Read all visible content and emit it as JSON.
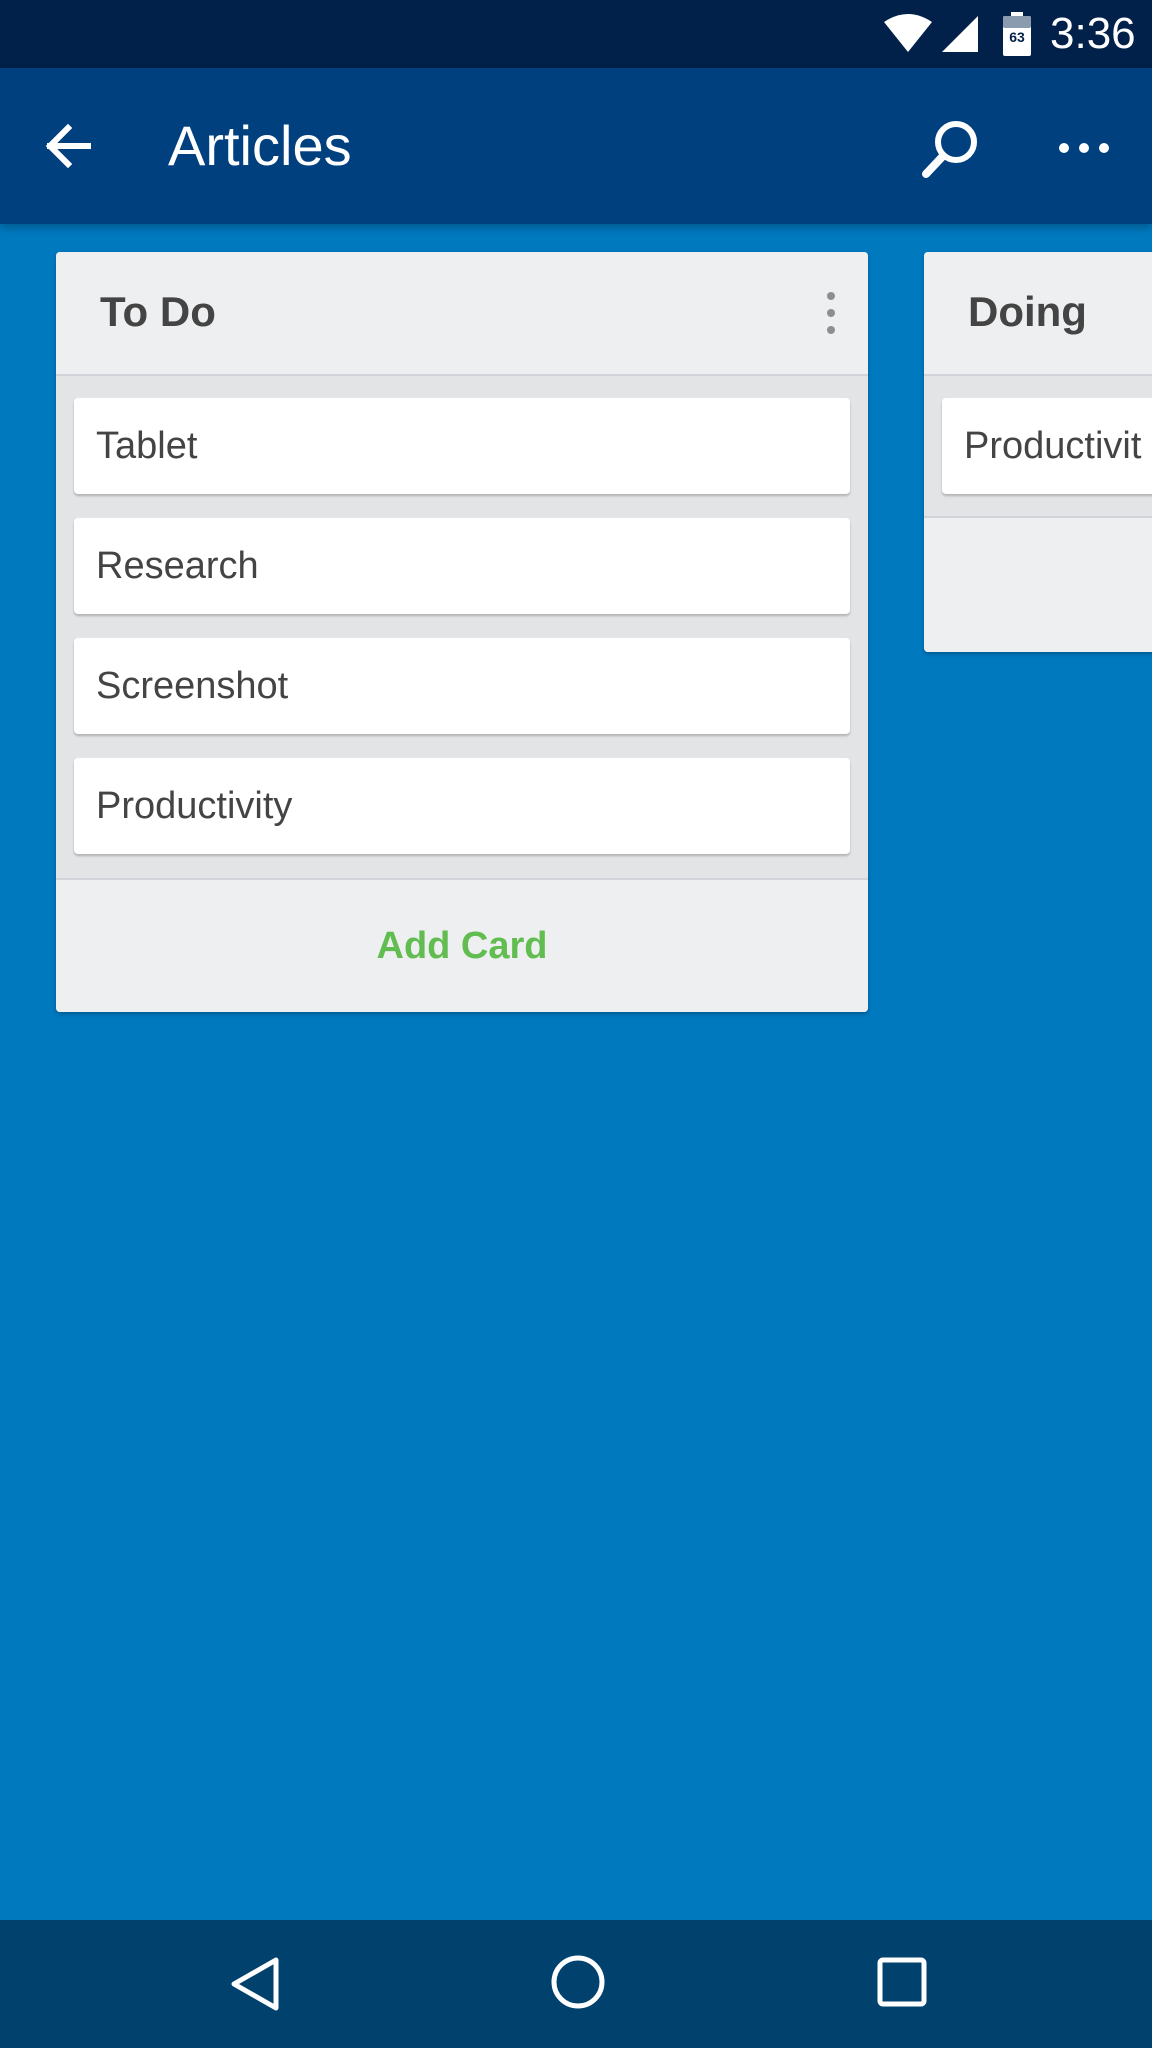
{
  "status_bar": {
    "time": "3:36",
    "battery_level": "63"
  },
  "app_bar": {
    "title": "Articles"
  },
  "lists": [
    {
      "title": "To Do",
      "cards": [
        "Tablet",
        "Research",
        "Screenshot",
        "Productivity"
      ],
      "add_card_label": "Add Card"
    },
    {
      "title": "Doing",
      "cards": [
        "Productivit"
      ]
    }
  ],
  "icons": {
    "back": "arrow-left-icon",
    "search": "search-icon",
    "more": "more-horizontal-icon",
    "list_menu": "more-vertical-icon",
    "nav_back": "triangle-back-icon",
    "nav_home": "circle-home-icon",
    "nav_recents": "square-recents-icon"
  },
  "colors": {
    "board_background": "#0079BF",
    "app_bar": "#01407F",
    "status_bar": "#02214A",
    "nav_bar": "#01416E",
    "add_card": "#61BD4F"
  }
}
